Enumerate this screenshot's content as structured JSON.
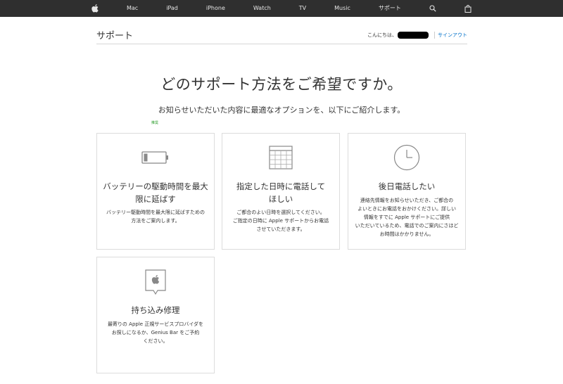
{
  "nav": {
    "apple_icon": "apple-logo-icon",
    "items": [
      "Mac",
      "iPad",
      "iPhone",
      "Watch",
      "TV",
      "Music",
      "サポート"
    ],
    "search_icon": "search-icon",
    "bag_icon": "shopping-bag-icon"
  },
  "header": {
    "title": "サポート",
    "greeting": "こんにちは、",
    "signout": "サインアウト"
  },
  "main": {
    "headline": "どのサポート方法をご希望ですか。",
    "subline": "お知らせいただいた内容に最適なオプションを、以下にご紹介します。",
    "recommended_badge": "推奨"
  },
  "cards": [
    {
      "icon": "battery-icon",
      "title_lines": [
        "バッテリーの駆動時間を最大",
        "限に延ばす"
      ],
      "desc_lines": [
        "バッテリー駆動時間を最大限に延ばすための",
        "方法をご案内します。"
      ]
    },
    {
      "icon": "calendar-icon",
      "title_lines": [
        "指定した日時に電話して",
        "ほしい"
      ],
      "desc_lines": [
        "ご都合のよい日時を選択してください。",
        "ご指定の日時に Apple サポートからお電話",
        "させていただきます。"
      ]
    },
    {
      "icon": "clock-icon",
      "title_lines": [
        "後日電話したい"
      ],
      "desc_lines": [
        "連絡先情報をお知らせいただき、ご都合の",
        "よいときにお電話をおかけください。詳しい",
        "情報をすでに Apple サポートにご提供",
        "いただいているため、電話でのご案内にさほど",
        "お時間はかかりません。"
      ]
    },
    {
      "icon": "apple-store-pin-icon",
      "title_lines": [
        "持ち込み修理"
      ],
      "desc_lines": [
        "最寄りの Apple 正規サービスプロバイダを",
        "お探しになるか、Genius Bar をご予約",
        "ください。"
      ]
    }
  ],
  "colors": {
    "nav_bg": "#2f2f2f",
    "link": "#0070c9",
    "recommended": "#2e9e2e",
    "card_border": "#dcdcdc"
  }
}
